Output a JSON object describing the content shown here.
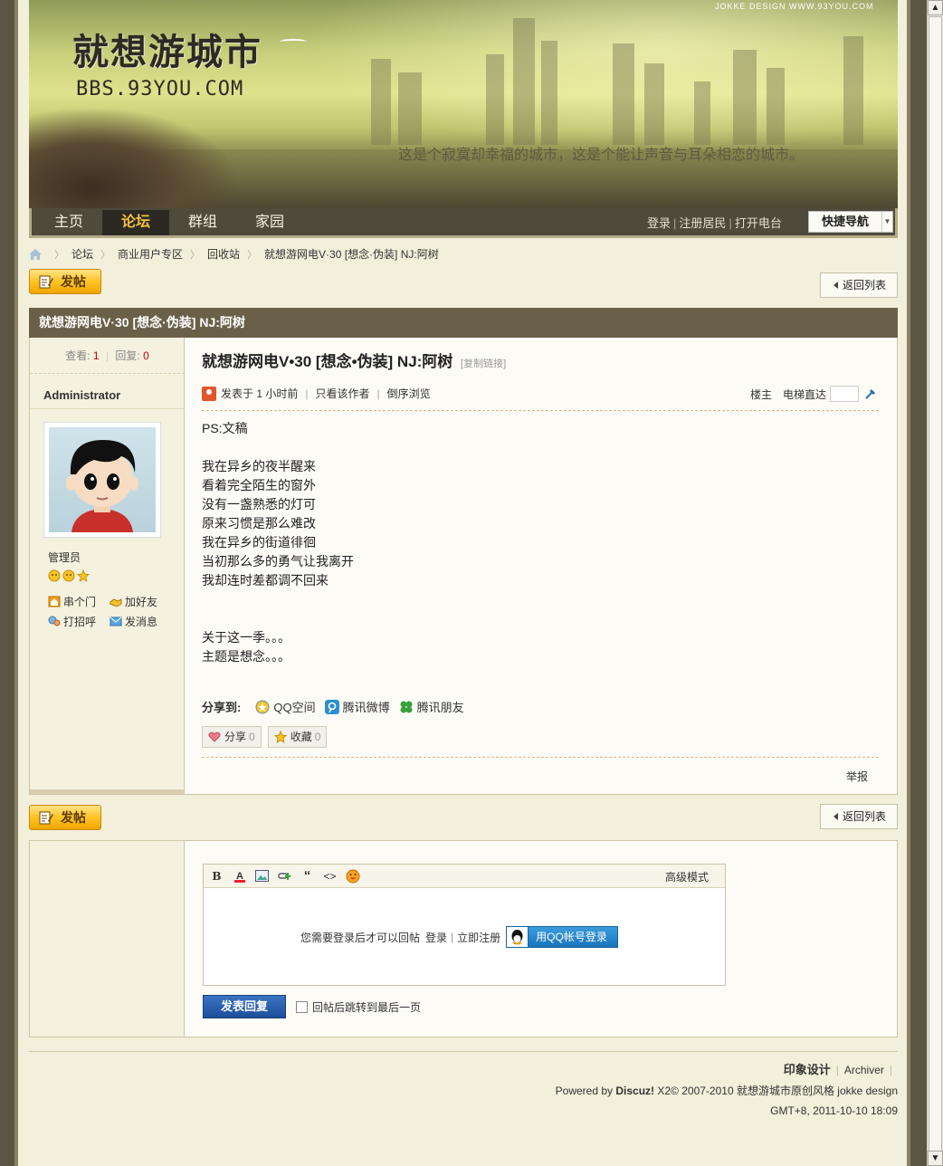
{
  "banner": {
    "logo": "就想游城市",
    "logo_url": "BBS.93YOU.COM",
    "slogan": "这是个寂寞却幸福的城市，这是个能让声音与耳朵相恋的城市。",
    "credit": "JOKKE DESIGN    WWW.93YOU.COM"
  },
  "nav": {
    "items": [
      {
        "label": "主页"
      },
      {
        "label": "论坛"
      },
      {
        "label": "群组"
      },
      {
        "label": "家园"
      }
    ],
    "login": "登录",
    "register": "注册居民",
    "radio": "打开电台",
    "quick_nav": "快捷导航"
  },
  "breadcrumb": {
    "items": [
      "论坛",
      "商业用户专区",
      "回收站",
      "就想游网电V·30 [想念·伪装] NJ:阿树"
    ]
  },
  "buttons": {
    "post": "发帖",
    "back": "返回列表"
  },
  "thread": {
    "title": "就想游网电V·30 [想念·伪装] NJ:阿树",
    "views_label": "查看:",
    "views": "1",
    "replies_label": "回复:",
    "replies": "0"
  },
  "author": {
    "name": "Administrator",
    "role": "管理员",
    "actions": {
      "visit": "串个门",
      "add_friend": "加好友",
      "greet": "打招呼",
      "message": "发消息"
    }
  },
  "post": {
    "title": "就想游网电V•30 [想念•伪装] NJ:阿树",
    "copy_link": "[复制链接]",
    "posted_at": "发表于  1 小时前",
    "only_author": "只看该作者",
    "reverse": "倒序浏览",
    "floor": "楼主",
    "elevator": "电梯直达",
    "lines": [
      "PS:文稿",
      "",
      "我在异乡的夜半醒来",
      "看着完全陌生的窗外",
      "没有一盏熟悉的灯可",
      "原来习惯是那么难改",
      "我在异乡的街道徘徊",
      "当初那么多的勇气让我离开",
      "我却连时差都调不回来",
      "",
      "",
      "关于这一季。。。",
      "主题是想念。。。"
    ],
    "share_label": "分享到:",
    "share_qzone": "QQ空间",
    "share_weibo": "腾讯微博",
    "share_friends": "腾讯朋友",
    "share_btn": "分享",
    "share_count": "0",
    "fav_btn": "收藏",
    "fav_count": "0",
    "report": "举报"
  },
  "reply": {
    "advanced": "高级模式",
    "need_login": "您需要登录后才可以回帖",
    "login": "登录",
    "register": "立即注册",
    "qq_login": "用QQ帐号登录",
    "submit": "发表回复",
    "jump_last": "回帖后跳转到最后一页"
  },
  "footer": {
    "brand": "印象设计",
    "archiver": "Archiver",
    "powered_prefix": "Powered by ",
    "powered_name": "Discuz!",
    "powered_suffix": " X2© 2007-2010 就想游城市原创风格 jokke design",
    "time": "GMT+8, 2011-10-10 18:09"
  },
  "colors": {
    "page_bg": "#f2efda",
    "title_bar": "#6a6048",
    "nav_bg": "#4e4a3c",
    "nav_active": "#f0c040",
    "count_red": "#cc0000",
    "post_btn": "#ffc424",
    "submit_btn": "#1c4e9a"
  }
}
